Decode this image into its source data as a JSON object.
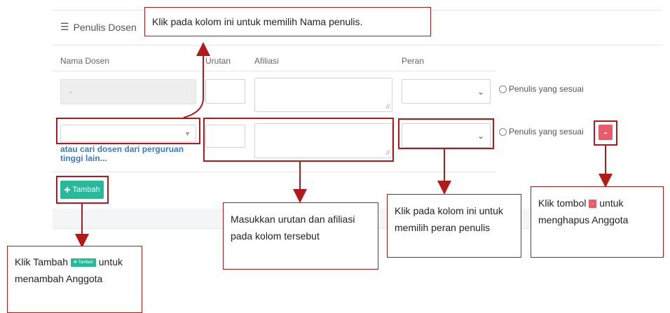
{
  "panel": {
    "title": "Penulis Dosen",
    "title_icon": "list-icon"
  },
  "table": {
    "headers": {
      "nama": "Nama Dosen",
      "urutan": "Urutan",
      "afiliasi": "Afiliasi",
      "peran": "Peran"
    },
    "rows": [
      {
        "nama_value": "-",
        "radio_label": "Penulis yang sesuai"
      },
      {
        "nama_value": "",
        "radio_label": "Penulis yang sesuai",
        "delete_label": "-"
      }
    ],
    "search_link": "atau cari dosen dari perguruan tinggi lain..."
  },
  "buttons": {
    "tambah_label": "Tambah",
    "tambah_icon": "plus-icon"
  },
  "callouts": {
    "nama": "Klik pada kolom ini untuk memilih Nama penulis.",
    "urutan": "Masukkan urutan dan afiliasi pada kolom tersebut",
    "peran": "Klik pada kolom ini untuk memilih peran penulis",
    "hapus_before": "Klik tombol",
    "hapus_button": "-",
    "hapus_after": "untuk menghapus Anggota",
    "tambah_before": "Klik Tambah",
    "tambah_button": "Tambah",
    "tambah_after": "untuk menambah Anggota"
  },
  "colors": {
    "annotation_red": "#b21a1a",
    "tambah_green": "#26b99a",
    "delete_red": "#e85a6c",
    "link_blue": "#3a7bc8"
  }
}
